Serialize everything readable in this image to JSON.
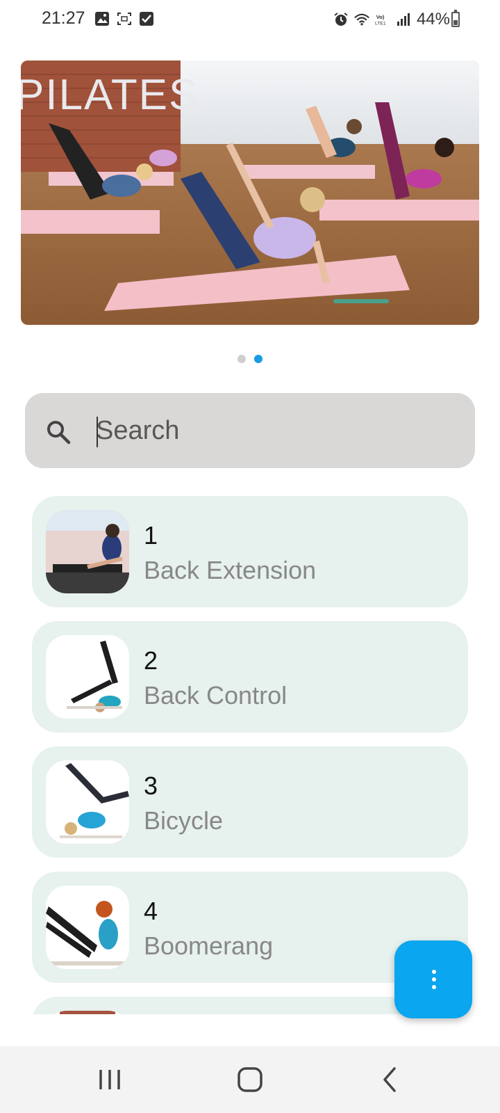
{
  "status_bar": {
    "time": "21:27",
    "battery": "44%",
    "left_icons": [
      "image-icon",
      "screenshot-icon",
      "checkbox-icon"
    ],
    "right_icons": [
      "alarm-icon",
      "wifi-icon",
      "volte-icon",
      "signal-icon",
      "battery-icon"
    ]
  },
  "banner": {
    "caption": "PILATES",
    "pages": 2,
    "active_page": 2
  },
  "search": {
    "placeholder": "Search",
    "value": ""
  },
  "exercises": [
    {
      "number": "1",
      "name": "Back Extension"
    },
    {
      "number": "2",
      "name": "Back Control"
    },
    {
      "number": "3",
      "name": "Bicycle"
    },
    {
      "number": "4",
      "name": "Boomerang"
    },
    {
      "number": "",
      "name": ""
    }
  ],
  "fab": {
    "icon": "more-vert-icon"
  },
  "nav": {
    "icons": [
      "recent-apps-icon",
      "home-icon",
      "back-icon"
    ]
  },
  "colors": {
    "accent": "#0aa6ef",
    "list_item_bg": "#e7f1ee",
    "search_bg": "#dad7d7"
  }
}
